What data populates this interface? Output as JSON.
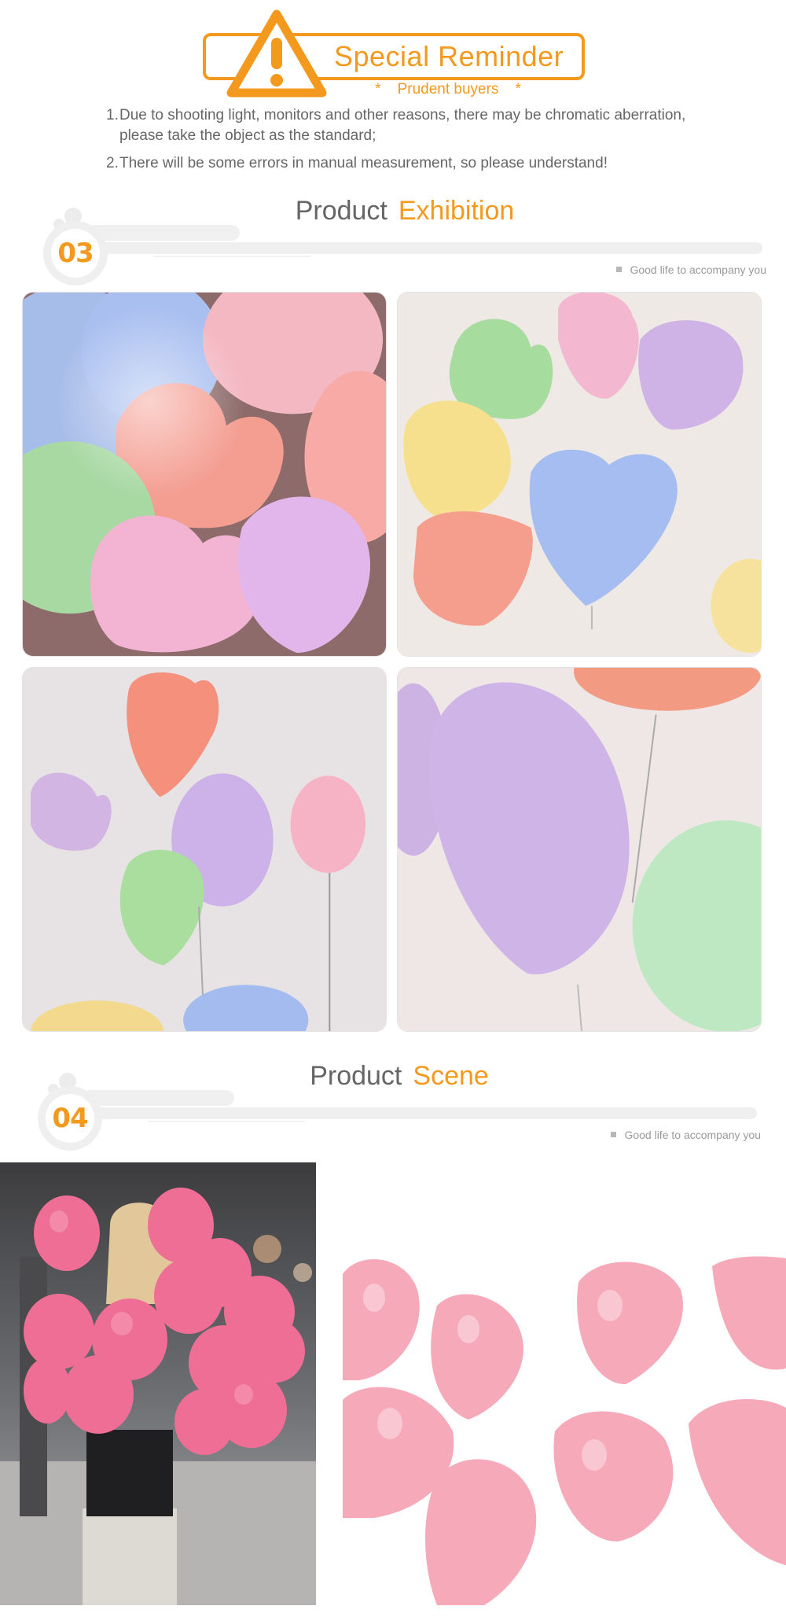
{
  "reminder": {
    "title": "Special Reminder",
    "subtitle": "*    Prudent buyers    *",
    "icon": "warning-icon",
    "accent_color": "#f39a1e",
    "notes": [
      {
        "num": "1.",
        "text": "Due to shooting light, monitors and other reasons, there may be chromatic aberration, please take the object as the standard;"
      },
      {
        "num": "2.",
        "text": "There will be some errors in manual measurement, so please understand!"
      }
    ]
  },
  "sections": [
    {
      "number": "03",
      "title_plain": "Product",
      "title_accent": "Exhibition",
      "tagline": "Good life to accompany you"
    },
    {
      "number": "04",
      "title_plain": "Product",
      "title_accent": "Scene",
      "tagline": "Good life to accompany you"
    }
  ],
  "exhibition_photos": [
    {
      "name": "pastel-heart-balloons-closeup"
    },
    {
      "name": "pastel-heart-balloons-on-floor"
    },
    {
      "name": "heart-balloons-against-wall"
    },
    {
      "name": "purple-heart-balloon-closeup"
    }
  ],
  "scene_photos": [
    {
      "name": "woman-holding-pink-balloons"
    },
    {
      "name": "pink-heart-balloons-flatlay"
    }
  ],
  "colors": {
    "accent": "#f39a1e",
    "text_gray": "#666666",
    "balloon_pink": "#f5a9bd",
    "balloon_blue": "#9fb6ea",
    "balloon_green": "#a7dca0",
    "balloon_purple": "#c9aee3",
    "balloon_coral": "#f49a86",
    "balloon_yellow": "#f6dc85"
  }
}
